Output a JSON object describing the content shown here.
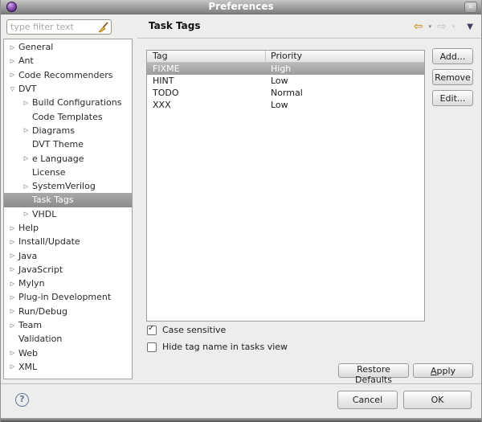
{
  "window": {
    "title": "Preferences"
  },
  "icons": {
    "close": "×",
    "back": "⇦",
    "forward": "⇨",
    "dropdown_small": "▾",
    "view_menu": "▼",
    "help": "?",
    "expander_collapsed": "▷",
    "expander_expanded": "▽",
    "clear_filter": "broom-icon",
    "app": "eclipse-orb"
  },
  "sidebar": {
    "filter": {
      "placeholder": "type filter text",
      "value": ""
    },
    "tree": [
      {
        "label": "General",
        "arrow": "▷"
      },
      {
        "label": "Ant",
        "arrow": "▷"
      },
      {
        "label": "Code Recommenders",
        "arrow": "▷"
      },
      {
        "label": "DVT",
        "arrow": "▽"
      },
      {
        "label": "Build Configurations",
        "arrow": "▷"
      },
      {
        "label": "Code Templates",
        "arrow": ""
      },
      {
        "label": "Diagrams",
        "arrow": "▷"
      },
      {
        "label": "DVT Theme",
        "arrow": ""
      },
      {
        "label": "e Language",
        "arrow": "▷"
      },
      {
        "label": "License",
        "arrow": ""
      },
      {
        "label": "SystemVerilog",
        "arrow": "▷"
      },
      {
        "label": "Task Tags",
        "arrow": ""
      },
      {
        "label": "VHDL",
        "arrow": "▷"
      },
      {
        "label": "Help",
        "arrow": "▷"
      },
      {
        "label": "Install/Update",
        "arrow": "▷"
      },
      {
        "label": "Java",
        "arrow": "▷"
      },
      {
        "label": "JavaScript",
        "arrow": "▷"
      },
      {
        "label": "Mylyn",
        "arrow": "▷"
      },
      {
        "label": "Plug-in Development",
        "arrow": "▷"
      },
      {
        "label": "Run/Debug",
        "arrow": "▷"
      },
      {
        "label": "Team",
        "arrow": "▷"
      },
      {
        "label": "Validation",
        "arrow": ""
      },
      {
        "label": "Web",
        "arrow": "▷"
      },
      {
        "label": "XML",
        "arrow": "▷"
      }
    ],
    "selected_item": "Task Tags"
  },
  "content": {
    "page_title": "Task Tags",
    "table": {
      "columns": [
        "Tag",
        "Priority"
      ],
      "rows": [
        {
          "tag": "FIXME",
          "priority": "High"
        },
        {
          "tag": "HINT",
          "priority": "Low"
        },
        {
          "tag": "TODO",
          "priority": "Normal"
        },
        {
          "tag": "XXX",
          "priority": "Low"
        }
      ],
      "selected_tag": "FIXME"
    },
    "side_buttons": {
      "add": "Add...",
      "remove": "Remove",
      "edit": "Edit..."
    },
    "checkboxes": [
      {
        "label": "Case sensitive",
        "checked": true,
        "mark": "✓"
      },
      {
        "label": "Hide tag name in tasks view",
        "checked": false,
        "mark": ""
      }
    ],
    "restore_defaults": {
      "label": "Restore Defaults",
      "pre": "Restore ",
      "mnemonic": "D",
      "post": "efaults"
    },
    "apply": {
      "label": "Apply",
      "pre": "",
      "mnemonic": "A",
      "post": "pply"
    }
  },
  "footer": {
    "cancel": "Cancel",
    "ok": "OK",
    "help": "?"
  },
  "colors": {
    "titlebar_top": "#c6c6c6",
    "titlebar_bottom": "#7c7c7c",
    "dialog_bg": "#ededeb",
    "selection_gray": "#9c9c9c",
    "back_arrow_gold": "#c79a2e",
    "view_menu_navy": "#3d3d62",
    "help_blue": "#68799c"
  }
}
